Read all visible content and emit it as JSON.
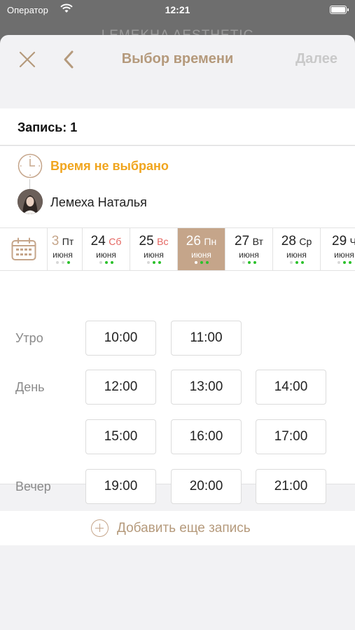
{
  "status": {
    "carrier": "Оператор",
    "time": "12:21"
  },
  "background_title": "LEMEKHA AESTHETIC",
  "nav": {
    "title": "Выбор времени",
    "next_label": "Далее",
    "close_icon": "close-icon",
    "back_icon": "chevron-left-icon"
  },
  "record": {
    "label": "Запись: 1"
  },
  "info": {
    "time_status": "Время не выбрано",
    "master_name": "Лемеха Наталья"
  },
  "days": [
    {
      "num": "3",
      "weekday": "Пт",
      "month": "июня",
      "weekend": false,
      "active": false,
      "dots": [
        "l",
        "l",
        "g"
      ]
    },
    {
      "num": "24",
      "weekday": "Сб",
      "month": "июня",
      "weekend": true,
      "active": false,
      "dots": [
        "l",
        "g",
        "g"
      ]
    },
    {
      "num": "25",
      "weekday": "Вс",
      "month": "июня",
      "weekend": true,
      "active": false,
      "dots": [
        "l",
        "g",
        "g"
      ]
    },
    {
      "num": "26",
      "weekday": "Пн",
      "month": "июня",
      "weekend": false,
      "active": true,
      "dots": [
        "l",
        "g",
        "g"
      ]
    },
    {
      "num": "27",
      "weekday": "Вт",
      "month": "июня",
      "weekend": false,
      "active": false,
      "dots": [
        "l",
        "g",
        "g"
      ]
    },
    {
      "num": "28",
      "weekday": "Ср",
      "month": "июня",
      "weekend": false,
      "active": false,
      "dots": [
        "l",
        "g",
        "g"
      ]
    },
    {
      "num": "29",
      "weekday": "Ч",
      "month": "июня",
      "weekend": false,
      "active": false,
      "dots": [
        "l",
        "g",
        "g"
      ]
    }
  ],
  "periods": {
    "morning": "Утро",
    "day": "День",
    "evening": "Вечер"
  },
  "slots": {
    "morning": [
      "10:00",
      "11:00"
    ],
    "day1": [
      "12:00",
      "13:00",
      "14:00"
    ],
    "day2": [
      "15:00",
      "16:00",
      "17:00"
    ],
    "evening": [
      "19:00",
      "20:00",
      "21:00"
    ]
  },
  "add_record": {
    "label": "Добавить еще запись"
  },
  "colors": {
    "accent": "#c5a58a",
    "title": "#b59a7c",
    "warning": "#f0a51e",
    "weekend": "#e4645f",
    "available": "#2bc12b"
  }
}
